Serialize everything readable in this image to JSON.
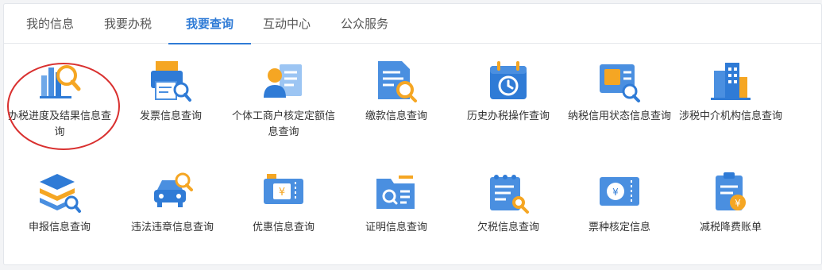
{
  "tabs": [
    {
      "label": "我的信息"
    },
    {
      "label": "我要办税"
    },
    {
      "label": "我要查询",
      "active": true
    },
    {
      "label": "互动中心"
    },
    {
      "label": "公众服务"
    }
  ],
  "accent_color": "#2f7bd6",
  "highlight_color": "#d9302f",
  "items": [
    {
      "label": "办税进度及结果信息查询",
      "icon": "bar-chart-search-icon"
    },
    {
      "label": "发票信息查询",
      "icon": "invoice-printer-search-icon"
    },
    {
      "label": "个体工商户核定定额信息查询",
      "icon": "person-card-icon"
    },
    {
      "label": "缴款信息查询",
      "icon": "document-search-icon"
    },
    {
      "label": "历史办税操作查询",
      "icon": "calendar-history-icon"
    },
    {
      "label": "纳税信用状态信息查询",
      "icon": "credit-card-search-icon"
    },
    {
      "label": "涉税中介机构信息查询",
      "icon": "building-search-icon"
    },
    {
      "label": "申报信息查询",
      "icon": "layers-search-icon"
    },
    {
      "label": "违法违章信息查询",
      "icon": "car-search-icon"
    },
    {
      "label": "优惠信息查询",
      "icon": "coupon-ticket-icon"
    },
    {
      "label": "证明信息查询",
      "icon": "folder-search-icon"
    },
    {
      "label": "欠税信息查询",
      "icon": "notepad-search-icon"
    },
    {
      "label": "票种核定信息",
      "icon": "ticket-search-icon"
    },
    {
      "label": "减税降费账单",
      "icon": "clipboard-yuan-icon"
    }
  ]
}
